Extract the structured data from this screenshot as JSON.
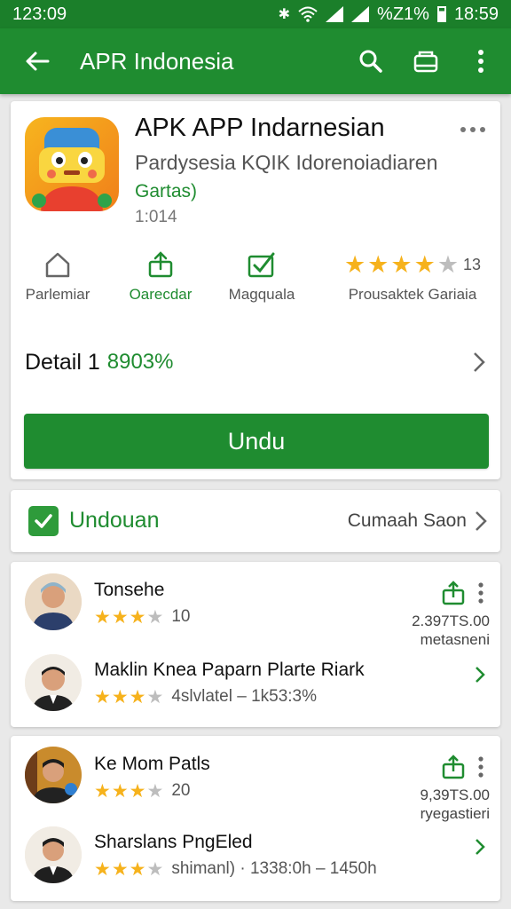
{
  "status": {
    "time_left": "123:09",
    "percent": "%Z1%",
    "time_right": "18:59"
  },
  "appbar": {
    "title": "APR Indonesia"
  },
  "app": {
    "title": "APK APP Indarnesian",
    "subtitle": "Pardysesia KQIK Idorenoiadiaren",
    "price": "Gartas)",
    "version": "1:014"
  },
  "quick_actions": [
    {
      "label": "Parlemiar",
      "icon": "home-outline-icon"
    },
    {
      "label": "Oarecdar",
      "icon": "share-icon"
    },
    {
      "label": "Magquala",
      "icon": "check-folder-icon"
    }
  ],
  "rating": {
    "value": 4,
    "max": 5,
    "count": "13",
    "label": "Prousaktek Gariaia"
  },
  "detail": {
    "label": "Detail 1",
    "value": "8903%"
  },
  "install": {
    "label": "Undu"
  },
  "status_row": {
    "label": "Undouan",
    "right": "Cumaah Saon"
  },
  "reviews": [
    {
      "name": "Tonsehe",
      "stars": 3,
      "meta": "10",
      "value_line1": "2.397TS.00",
      "value_line2": "metasneni"
    },
    {
      "name": "Maklin Knea Paparn Plarte Riark",
      "stars": 3,
      "meta": "4slvlatel  – 1k53:3%"
    },
    {
      "name": "Ke Mom Patls",
      "stars": 3,
      "meta": "20",
      "value_line1": "9,39TS.00",
      "value_line2": "ryegastieri"
    },
    {
      "name": "Sharslans PngEled",
      "stars": 3,
      "meta": "shimanl)  · 1338:0h  –  1450h"
    }
  ],
  "colors": {
    "primary": "#1f8c30",
    "star": "#f6b21c"
  }
}
